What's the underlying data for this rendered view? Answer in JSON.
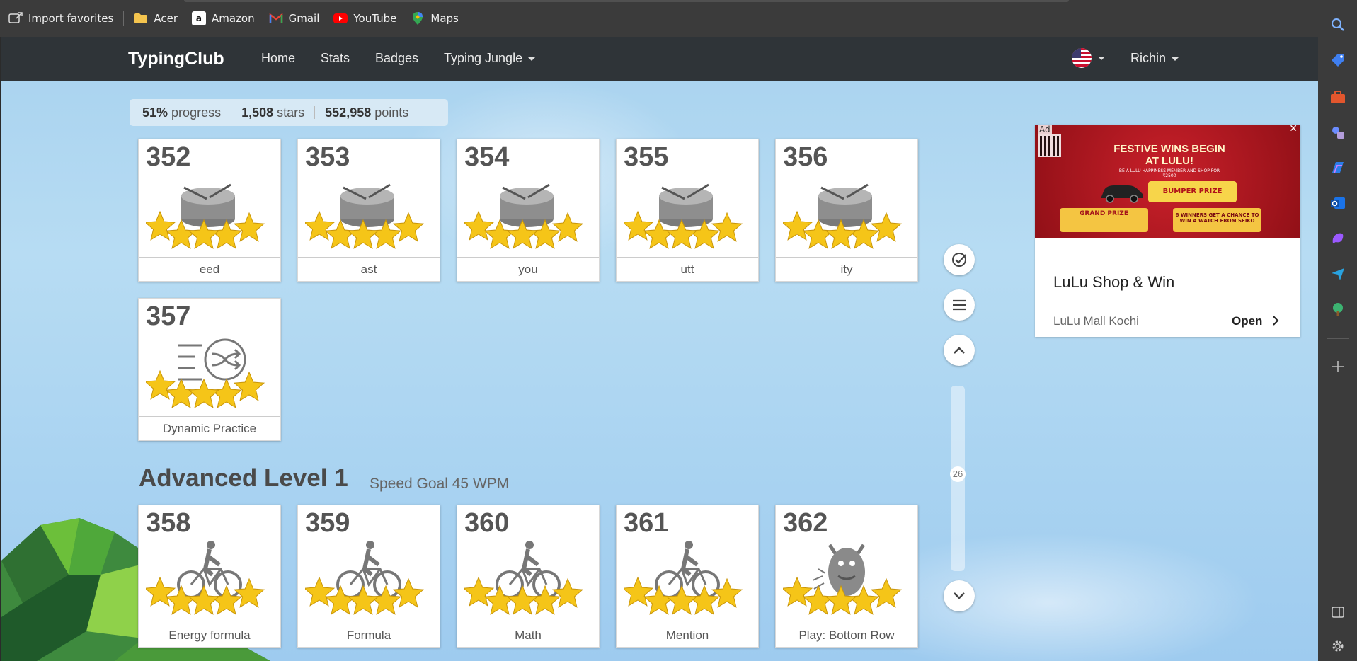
{
  "favorites": [
    {
      "label": "Import favorites",
      "icon": "import-icon"
    },
    {
      "label": "Acer",
      "icon": "folder-icon"
    },
    {
      "label": "Amazon",
      "icon": "amazon-icon"
    },
    {
      "label": "Gmail",
      "icon": "gmail-icon"
    },
    {
      "label": "YouTube",
      "icon": "youtube-icon"
    },
    {
      "label": "Maps",
      "icon": "maps-icon"
    }
  ],
  "nav": {
    "brand": "TypingClub",
    "links": [
      "Home",
      "Stats",
      "Badges",
      "Typing Jungle"
    ],
    "user": "Richin",
    "flag": "us-flag-icon"
  },
  "progress": {
    "percent": "51%",
    "percent_label": "progress",
    "stars": "1,508",
    "stars_label": "stars",
    "points": "552,958",
    "points_label": "points"
  },
  "lessons_row1": [
    {
      "num": "352",
      "label": "eed",
      "icon": "drum-icon",
      "stars": 5
    },
    {
      "num": "353",
      "label": "ast",
      "icon": "drum-icon",
      "stars": 5
    },
    {
      "num": "354",
      "label": "you",
      "icon": "drum-icon",
      "stars": 5
    },
    {
      "num": "355",
      "label": "utt",
      "icon": "drum-icon",
      "stars": 5
    },
    {
      "num": "356",
      "label": "ity",
      "icon": "drum-icon",
      "stars": 5
    }
  ],
  "lessons_row2": [
    {
      "num": "357",
      "label": "Dynamic Practice",
      "icon": "shuffle-icon",
      "stars": 5
    }
  ],
  "section": {
    "title": "Advanced Level 1",
    "subtitle": "Speed Goal 45 WPM"
  },
  "lessons_row3": [
    {
      "num": "358",
      "label": "Energy formula",
      "icon": "bicycle-icon",
      "stars": 5
    },
    {
      "num": "359",
      "label": "Formula",
      "icon": "bicycle-icon",
      "stars": 5
    },
    {
      "num": "360",
      "label": "Math",
      "icon": "bicycle-icon",
      "stars": 5
    },
    {
      "num": "361",
      "label": "Mention",
      "icon": "bicycle-icon",
      "stars": 5
    },
    {
      "num": "362",
      "label": "Play: Bottom Row",
      "icon": "monster-icon",
      "stars": 5
    }
  ],
  "scroll": {
    "position": "26"
  },
  "ad": {
    "badge": "Ad",
    "headline": "FESTIVE WINS BEGIN AT LULU!",
    "subhead": "BE A LULU HAPPINESS MEMBER AND SHOP FOR ₹2500",
    "prize_main": "BUMPER PRIZE",
    "prize_grand": "GRAND PRIZE",
    "prize_watch": "6 WINNERS GET A CHANCE TO WIN A WATCH FROM SEIKO",
    "title": "LuLu Shop & Win",
    "location": "LuLu Mall Kochi",
    "cta": "Open"
  },
  "colors": {
    "nav_bg": "#2f3438",
    "star_gold": "#f5c518",
    "ad_red": "#c9202a"
  }
}
